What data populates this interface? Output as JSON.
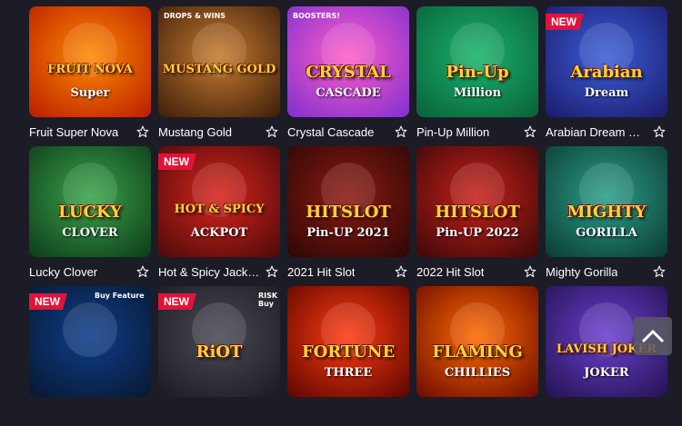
{
  "games": [
    {
      "title": "Fruit Super Nova",
      "art": "FRUIT NOVA",
      "art2": "Super",
      "bg1": "#ff8a00",
      "bg2": "#b81d00",
      "badge": ""
    },
    {
      "title": "Mustang Gold",
      "art": "MUSTANG GOLD",
      "art2": "",
      "bg1": "#c77b30",
      "bg2": "#3b1d0a",
      "badge": "",
      "corner": "DROPS & WINS"
    },
    {
      "title": "Crystal Cascade",
      "art": "CRYSTAL",
      "art2": "CASCADE",
      "bg1": "#ff5ec8",
      "bg2": "#7e2fd0",
      "badge": "",
      "corner": "BOOSTERS!"
    },
    {
      "title": "Pin-Up Million",
      "art": "Pin-Up",
      "art2": "Million",
      "bg1": "#19b36b",
      "bg2": "#0a5f3a",
      "badge": ""
    },
    {
      "title": "Arabian Dream Re…",
      "art": "Arabian",
      "art2": "Dream",
      "bg1": "#3a5fd9",
      "bg2": "#1b1a6a",
      "badge": "NEW"
    },
    {
      "title": "Lucky Clover",
      "art": "LUCKY",
      "art2": "CLOVER",
      "bg1": "#3aa34a",
      "bg2": "#0d3a18",
      "badge": ""
    },
    {
      "title": "Hot & Spicy Jack…",
      "art": "HOT & SPICY",
      "art2": "ACKPOT",
      "bg1": "#d8241b",
      "bg2": "#4a0a0a",
      "badge": "NEW"
    },
    {
      "title": "2021 Hit Slot",
      "art": "HITSLOT",
      "art2": "Pin-UP 2021",
      "bg1": "#8c1a12",
      "bg2": "#2b0706",
      "badge": ""
    },
    {
      "title": "2022 Hit Slot",
      "art": "HITSLOT",
      "art2": "Pin-UP 2022",
      "bg1": "#c8211a",
      "bg2": "#3a0808",
      "badge": ""
    },
    {
      "title": "Mighty Gorilla",
      "art": "MIGHTY",
      "art2": "GORILLA",
      "bg1": "#2c9e8a",
      "bg2": "#0b3a30",
      "badge": ""
    },
    {
      "title": "",
      "art": "",
      "art2": "",
      "bg1": "#0e3e8a",
      "bg2": "#08172f",
      "badge": "NEW",
      "corner": "Buy Feature"
    },
    {
      "title": "",
      "art": "RiOT",
      "art2": "",
      "bg1": "#4a4a55",
      "bg2": "#1a1a20",
      "badge": "NEW",
      "corner": "RISK Buy"
    },
    {
      "title": "",
      "art": "FORTUNE",
      "art2": "THREE",
      "bg1": "#ff3b10",
      "bg2": "#5a0500",
      "badge": ""
    },
    {
      "title": "",
      "art": "FLAMING",
      "art2": "CHILLIES",
      "bg1": "#ff6a00",
      "bg2": "#6a0a00",
      "badge": ""
    },
    {
      "title": "",
      "art": "LAVISH JOKER",
      "art2": "JOKER",
      "bg1": "#6b3fd0",
      "bg2": "#22124f",
      "badge": ""
    }
  ],
  "favorite_icon": "star-outline-icon",
  "scroll_icon": "chevron-up-icon"
}
